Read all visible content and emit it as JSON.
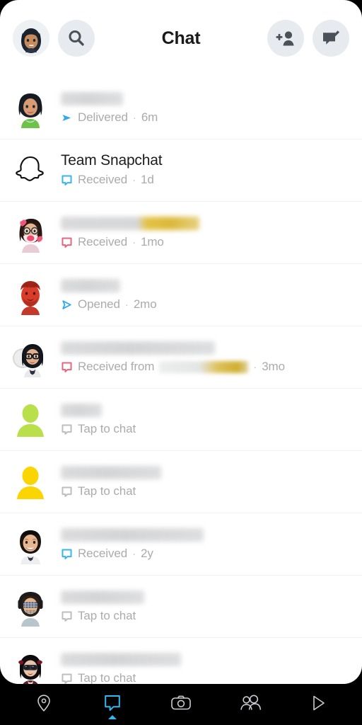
{
  "app": {
    "name": "Snapchat",
    "screen": "Chat"
  },
  "colors": {
    "accent_blue": "#2ea9f0",
    "accent_cyan": "#35b6f0",
    "received_pink": "#e8637f",
    "tap_gray": "#bcbec0",
    "text_primary": "#1b1c1d",
    "text_secondary": "#a9abad",
    "chip_bg": "#e7eaee",
    "nav_bg": "#000000",
    "sheet_bg": "#ffffff",
    "divider": "#f1f2f3"
  },
  "header": {
    "title": "Chat",
    "profile_avatar_alt": "profile-bitmoji",
    "search_label": "Search",
    "add_friend_label": "Add Friend",
    "new_chat_label": "New Chat"
  },
  "chats": [
    {
      "name": "",
      "name_redacted": true,
      "name_bar_width": 88,
      "name_bar_style": "gray",
      "status": "Delivered",
      "status_icon": "arrow-filled",
      "status_color": "#2ea9f0",
      "separator": "·",
      "time": "6m",
      "avatar": "bitmoji-dark-hair-green-top"
    },
    {
      "name": "Team Snapchat",
      "name_redacted": false,
      "status": "Received",
      "status_icon": "chat-square-outline",
      "status_color": "#35b6f0",
      "separator": "·",
      "time": "1d",
      "avatar": "snapchat-ghost"
    },
    {
      "name": "",
      "name_redacted": true,
      "name_bar_width": 196,
      "name_bar_style": "gold",
      "status": "Received",
      "status_icon": "chat-square-outline",
      "status_color": "#e8637f",
      "separator": "·",
      "time": "1mo",
      "avatar": "bitmoji-heart-glasses-mask"
    },
    {
      "name": "",
      "name_redacted": true,
      "name_bar_width": 84,
      "name_bar_style": "gray",
      "status": "Opened",
      "status_icon": "arrow-outline",
      "status_color": "#2ea9f0",
      "separator": "·",
      "time": "2mo",
      "avatar": "bitmoji-red-beard"
    },
    {
      "name": "",
      "name_redacted": true,
      "name_bar_width": 218,
      "name_bar_style": "gray",
      "status": "Received from",
      "status_icon": "chat-square-outline",
      "status_color": "#e8637f",
      "status_has_inline_redaction": true,
      "inline_bar_width": 126,
      "separator": "·",
      "time": "3mo",
      "avatar": "group-bitmoji-glasses"
    },
    {
      "name": "",
      "name_redacted": true,
      "name_bar_width": 58,
      "name_bar_style": "gray",
      "status": "Tap to chat",
      "status_icon": "chat-square-outline",
      "status_color": "#bcbec0",
      "separator": "",
      "time": "",
      "avatar": "default-silhouette-green"
    },
    {
      "name": "",
      "name_redacted": true,
      "name_bar_width": 142,
      "name_bar_style": "gray",
      "status": "Tap to chat",
      "status_icon": "chat-square-outline",
      "status_color": "#bcbec0",
      "separator": "",
      "time": "",
      "avatar": "default-silhouette-yellow"
    },
    {
      "name": "",
      "name_redacted": true,
      "name_bar_width": 202,
      "name_bar_style": "gray",
      "status": "Received",
      "status_icon": "chat-square-outline",
      "status_color": "#35b6f0",
      "separator": "·",
      "time": "2y",
      "avatar": "bitmoji-dark-hair-man"
    },
    {
      "name": "",
      "name_redacted": true,
      "name_bar_width": 118,
      "name_bar_style": "gray",
      "status": "Tap to chat",
      "status_icon": "chat-square-outline",
      "status_color": "#bcbec0",
      "separator": "",
      "time": "",
      "avatar": "bitmoji-headphones-sunglasses"
    },
    {
      "name": "",
      "name_redacted": true,
      "name_bar_width": 170,
      "name_bar_style": "gray",
      "status": "Tap to chat",
      "status_icon": "chat-square-outline",
      "status_color": "#bcbec0",
      "separator": "",
      "time": "",
      "avatar": "bitmoji-black-hair-sunglasses"
    }
  ],
  "navbar": {
    "active": "chat",
    "items": [
      {
        "id": "map",
        "label": "Map",
        "icon": "location-pin-icon",
        "active": false
      },
      {
        "id": "chat",
        "label": "Chat",
        "icon": "chat-bubble-icon",
        "active": true
      },
      {
        "id": "camera",
        "label": "Camera",
        "icon": "camera-icon",
        "active": false
      },
      {
        "id": "friends",
        "label": "Friends",
        "icon": "people-icon",
        "active": false
      },
      {
        "id": "spotlight",
        "label": "Spotlight",
        "icon": "play-triangle-icon",
        "active": false
      }
    ]
  }
}
